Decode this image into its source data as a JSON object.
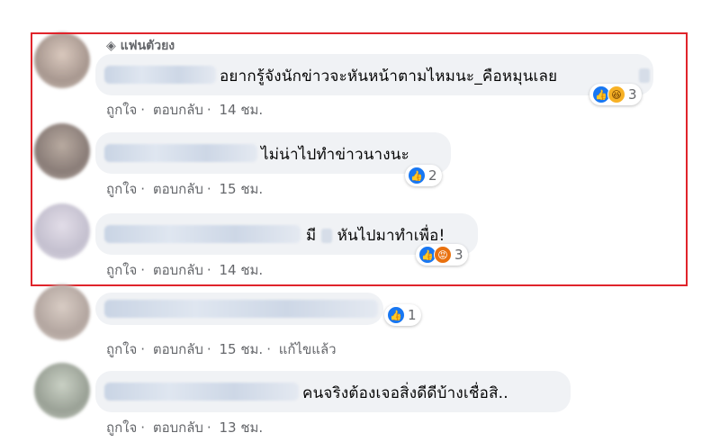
{
  "comments": [
    {
      "badge": "แฟนตัวยง",
      "text": "อยากรู้จังนักข่าวจะหันหน้าตามไหมนะ_คือหมุนเลย",
      "like_label": "ถูกใจ",
      "reply_label": "ตอบกลับ",
      "time": "14 ชม.",
      "reaction_count": "3",
      "reactions": [
        "like-icon",
        "haha-icon"
      ]
    },
    {
      "text": "ไม่น่าไปทำข่าวนางนะ",
      "like_label": "ถูกใจ",
      "reply_label": "ตอบกลับ",
      "time": "15 ชม.",
      "reaction_count": "2",
      "reactions": [
        "like-icon"
      ]
    },
    {
      "text_a": "มี",
      "text_b": "หันไปมาทำเพื่อ!",
      "like_label": "ถูกใจ",
      "reply_label": "ตอบกลับ",
      "time": "14 ชม.",
      "reaction_count": "3",
      "reactions": [
        "like-icon",
        "angry-icon"
      ]
    },
    {
      "like_label": "ถูกใจ",
      "reply_label": "ตอบกลับ",
      "time": "15 ชม.",
      "edited": "แก้ไขแล้ว",
      "reaction_count": "1",
      "reactions": [
        "like-icon"
      ]
    },
    {
      "text": "คนจริงต้องเจอสิ่งดีดีบ้างเชื่อสิ..",
      "like_label": "ถูกใจ",
      "reply_label": "ตอบกลับ",
      "time": "13 ชม."
    }
  ],
  "colors": {
    "highlight": "#e0242b",
    "like": "#1877f2",
    "bubble": "#f0f2f5"
  }
}
